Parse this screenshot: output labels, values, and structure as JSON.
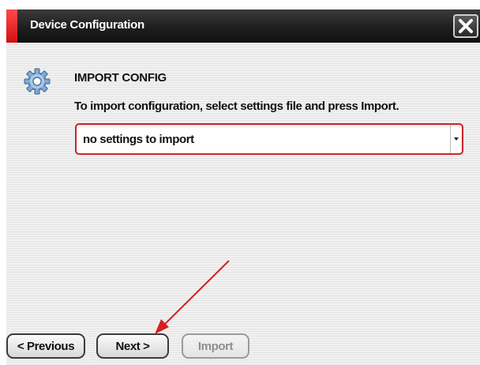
{
  "window": {
    "title": "Device Configuration",
    "close_icon": "close-x-icon",
    "accent_color": "#d81a1a"
  },
  "section": {
    "icon": "gear-icon",
    "heading": "IMPORT CONFIG",
    "instructions": "To import configuration, select settings file and press Import."
  },
  "settings_select": {
    "value": "no settings to import",
    "arrow_icon": "dropdown-arrow-icon",
    "border_color": "#c8262c"
  },
  "buttons": {
    "previous": "< Previous",
    "next": "Next >",
    "import": "Import"
  },
  "annotation": {
    "arrow_color": "#d42020"
  }
}
